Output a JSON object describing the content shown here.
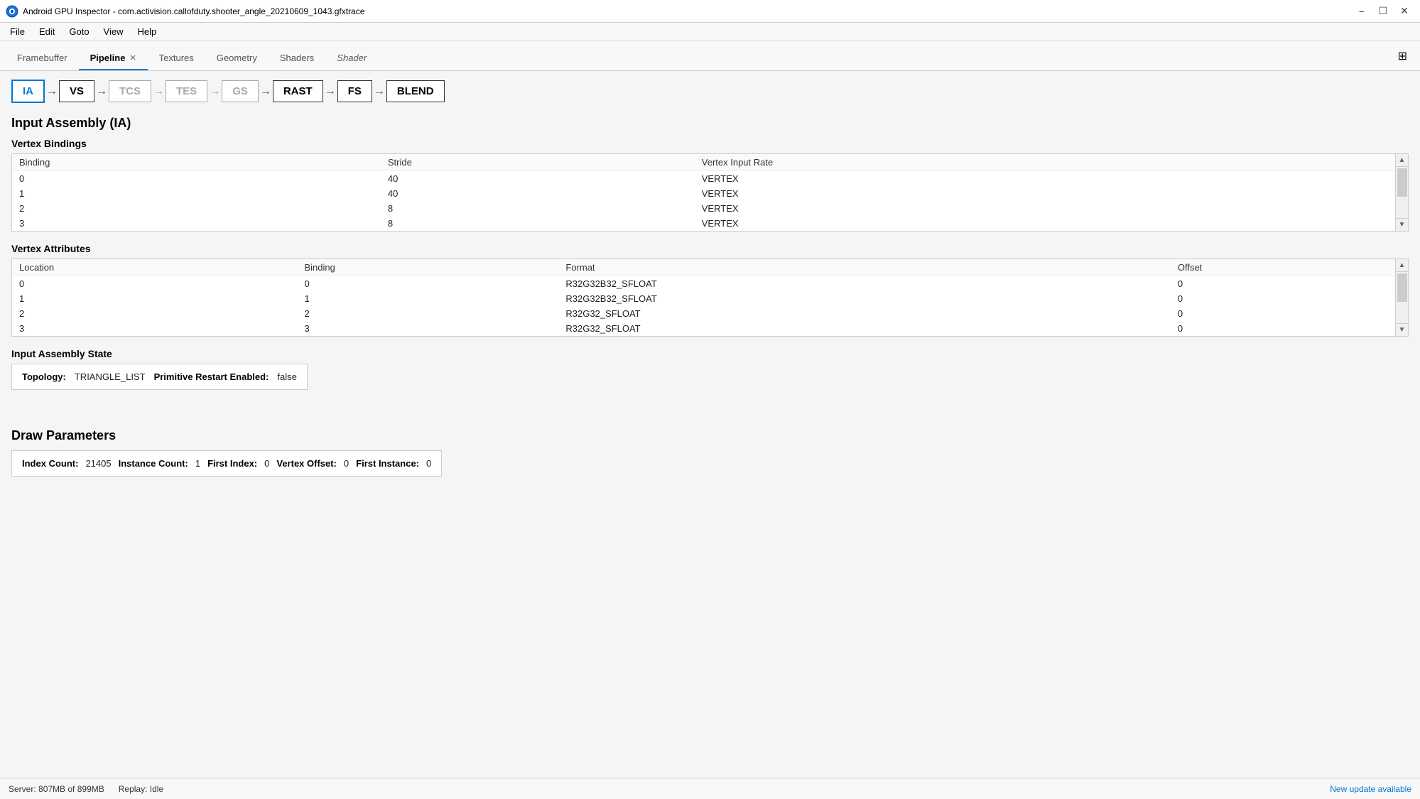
{
  "titleBar": {
    "appName": "Android GPU Inspector",
    "traceFile": "com.activision.callofduty.shooter_angle_20210609_1043.gfxtrace",
    "fullTitle": "Android GPU Inspector - com.activision.callofduty.shooter_angle_20210609_1043.gfxtrace"
  },
  "menuBar": {
    "items": [
      "File",
      "Edit",
      "Goto",
      "View",
      "Help"
    ]
  },
  "tabs": [
    {
      "id": "framebuffer",
      "label": "Framebuffer",
      "active": false,
      "closable": false
    },
    {
      "id": "pipeline",
      "label": "Pipeline",
      "active": true,
      "closable": true
    },
    {
      "id": "textures",
      "label": "Textures",
      "active": false,
      "closable": false
    },
    {
      "id": "geometry",
      "label": "Geometry",
      "active": false,
      "closable": false
    },
    {
      "id": "shaders",
      "label": "Shaders",
      "active": false,
      "closable": false
    },
    {
      "id": "shader",
      "label": "Shader",
      "active": false,
      "closable": false,
      "italic": true
    }
  ],
  "pipeline": {
    "stages": [
      {
        "id": "ia",
        "label": "IA",
        "active": true,
        "disabled": false
      },
      {
        "id": "vs",
        "label": "VS",
        "active": false,
        "disabled": false
      },
      {
        "id": "tcs",
        "label": "TCS",
        "active": false,
        "disabled": true
      },
      {
        "id": "tes",
        "label": "TES",
        "active": false,
        "disabled": true
      },
      {
        "id": "gs",
        "label": "GS",
        "active": false,
        "disabled": true
      },
      {
        "id": "rast",
        "label": "RAST",
        "active": false,
        "disabled": false
      },
      {
        "id": "fs",
        "label": "FS",
        "active": false,
        "disabled": false
      },
      {
        "id": "blend",
        "label": "BLEND",
        "active": false,
        "disabled": false
      }
    ]
  },
  "inputAssembly": {
    "title": "Input Assembly (IA)",
    "vertexBindings": {
      "title": "Vertex Bindings",
      "columns": [
        "Binding",
        "Stride",
        "Vertex Input Rate"
      ],
      "rows": [
        {
          "binding": "0",
          "stride": "40",
          "rate": "VERTEX"
        },
        {
          "binding": "1",
          "stride": "40",
          "rate": "VERTEX"
        },
        {
          "binding": "2",
          "stride": "8",
          "rate": "VERTEX"
        },
        {
          "binding": "3",
          "stride": "8",
          "rate": "VERTEX"
        }
      ]
    },
    "vertexAttributes": {
      "title": "Vertex Attributes",
      "columns": [
        "Location",
        "Binding",
        "Format",
        "Offset"
      ],
      "rows": [
        {
          "location": "0",
          "binding": "0",
          "format": "R32G32B32_SFLOAT",
          "offset": "0"
        },
        {
          "location": "1",
          "binding": "1",
          "format": "R32G32B32_SFLOAT",
          "offset": "0"
        },
        {
          "location": "2",
          "binding": "2",
          "format": "R32G32_SFLOAT",
          "offset": "0"
        },
        {
          "location": "3",
          "binding": "3",
          "format": "R32G32_SFLOAT",
          "offset": "0"
        }
      ]
    },
    "assemblyState": {
      "title": "Input Assembly State",
      "topologyLabel": "Topology:",
      "topologyValue": "TRIANGLE_LIST",
      "primitiveRestartLabel": "Primitive Restart Enabled:",
      "primitiveRestartValue": "false"
    }
  },
  "drawParameters": {
    "title": "Draw Parameters",
    "indexCountLabel": "Index Count:",
    "indexCountValue": "21405",
    "instanceCountLabel": "Instance Count:",
    "instanceCountValue": "1",
    "firstIndexLabel": "First Index:",
    "firstIndexValue": "0",
    "vertexOffsetLabel": "Vertex Offset:",
    "vertexOffsetValue": "0",
    "firstInstanceLabel": "First Instance:",
    "firstInstanceValue": "0"
  },
  "statusBar": {
    "serverLabel": "Server:",
    "serverMemory": "807MB of 899MB",
    "replayLabel": "Replay:",
    "replayStatus": "Idle",
    "updateLink": "New update available"
  },
  "expandIcon": "⊞"
}
